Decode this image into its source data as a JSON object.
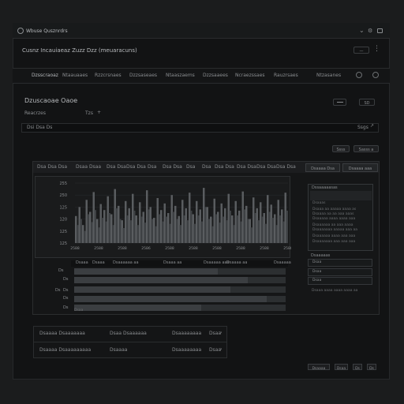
{
  "window": {
    "title": "Wbuse Qusznrdrs",
    "controls": [
      "chevron-down-icon",
      "gear-icon",
      "window-icon"
    ]
  },
  "header": {
    "title": "Cusnz Incauiaeaz Zuzz Dzz (meuaracuns)",
    "button_label": "—"
  },
  "nav": {
    "items": [
      "Dzsscraoaz",
      "Ntaauaaes",
      "Rzzcrsnaes",
      "Dzzsaseaes",
      "Ntaaszaems",
      "Dzzsaaees",
      "Ncraezssaes",
      "Rauzrsaes",
      "Ntzasanes"
    ]
  },
  "section": {
    "title": "Dzuscaoae Oaoe",
    "subtitle_left": "Reacrzes",
    "subtitle_mid": "Tzs",
    "subtitle_mid_icon": "plus-icon",
    "btn_a": "",
    "btn_b": "SD"
  },
  "filter": {
    "left": "Dsi Dsa Ds",
    "right": "Ssgs"
  },
  "panel_toolbar": {
    "btn_1": "Ssss",
    "btn_2": "Sasss a"
  },
  "columns": [
    "Dsa Dsa Dsa",
    "Dsaa Dsaa",
    "Dsa Dsa",
    "Dsa Dsa",
    "Dsa",
    "Dsa Dsa",
    "Dsa",
    "Dsa",
    "Dsa Dsa",
    "Dsa Dsa",
    "Dsa Dsa",
    "Dsa Dsa"
  ],
  "column_actions": [
    "Dsaaaa Dsa",
    "Dsaaaa aaa"
  ],
  "chart_data": {
    "type": "bar",
    "ytick_labels": [
      "255",
      "250",
      "125",
      "120",
      "125",
      "125"
    ],
    "xtick_labels": [
      "2588",
      "2588",
      "2588",
      "2586",
      "2588",
      "2588",
      "2588",
      "2588",
      "2588",
      "2588"
    ],
    "series": [
      {
        "values": [
          45,
          60,
          30,
          72,
          52,
          85,
          40,
          65,
          55,
          78,
          48,
          90,
          62,
          38,
          70,
          58,
          82,
          46,
          68,
          52,
          88,
          60,
          42,
          75,
          55,
          66,
          50,
          80,
          62,
          45,
          72,
          58,
          84,
          48,
          70,
          56,
          92,
          60,
          44,
          74,
          52,
          66,
          58,
          82,
          46,
          70,
          54,
          86,
          62,
          40,
          76,
          58,
          68,
          50,
          80,
          64,
          48,
          72,
          56,
          84
        ]
      },
      {
        "values": [
          30,
          40,
          20,
          48,
          35,
          55,
          26,
          42,
          36,
          50,
          30,
          58,
          40,
          25,
          46,
          38,
          54,
          30,
          44,
          34,
          56,
          40,
          28,
          48,
          36,
          44,
          32,
          52,
          40,
          30,
          46,
          38,
          54,
          32,
          46,
          36,
          60,
          40,
          28,
          48,
          34,
          44,
          38,
          54,
          30,
          46,
          36,
          56,
          40,
          26,
          50,
          38,
          44,
          32,
          52,
          42,
          30,
          46,
          36,
          54
        ]
      }
    ]
  },
  "sidepanel_top": {
    "title": "Dssaaaaasas",
    "lines": [
      "Dsaaas",
      "Dsaaa aa aaaaa aaaa as",
      "Dsaaaa aa aa aaa aaas",
      "Dsaaaaa aaaa aaaa aaa",
      "Dsaaaaaa aa aaa aaaa",
      "Dsaaaaaaa aaaaa aaa aa",
      "Dsaaaaaa aaaa aaa aaa",
      "Dsaaaaaaa aaa aaa aaa"
    ]
  },
  "timeline": {
    "headers": [
      "Dsaaa",
      "Dsaaa",
      "Dsaaaaaa aa",
      "Dsaaa aa",
      "Dsaaaaa aaa",
      "Dsaaaa aa",
      "Dsaaaaa"
    ],
    "row_labels": [
      "Ds",
      "Ds",
      "Ds",
      "Ds",
      "Ds"
    ],
    "row_side": "Ds",
    "row_values": [
      68,
      82,
      74,
      91,
      60
    ],
    "footer": "Dsaa"
  },
  "sidepanel_bottom": {
    "title": "Dsaaaaas",
    "items": [
      "Dsaa",
      "Dsaa",
      "Dsaa"
    ],
    "footer": "Dsaaa aaaa aaaa aaaa aa"
  },
  "footer_table": {
    "rows": [
      {
        "a": "Dsaaaa Dsaaaaaaa",
        "b": "Dsaa Dsaaaaaa",
        "c": "Dsaaaaaaaa",
        "d": "Dsaa",
        "icon": "chevron-right-icon"
      },
      {
        "a": "Dsaaaa Dsaaaaaaaaa",
        "b": "Dsaaaa",
        "c": "Dsaaaaaaaa",
        "d": "Dsaa",
        "icon": "chevron-right-icon"
      }
    ]
  },
  "pagination": [
    "Dsaaaa",
    "Dsaa",
    "Ds",
    "Ds"
  ]
}
